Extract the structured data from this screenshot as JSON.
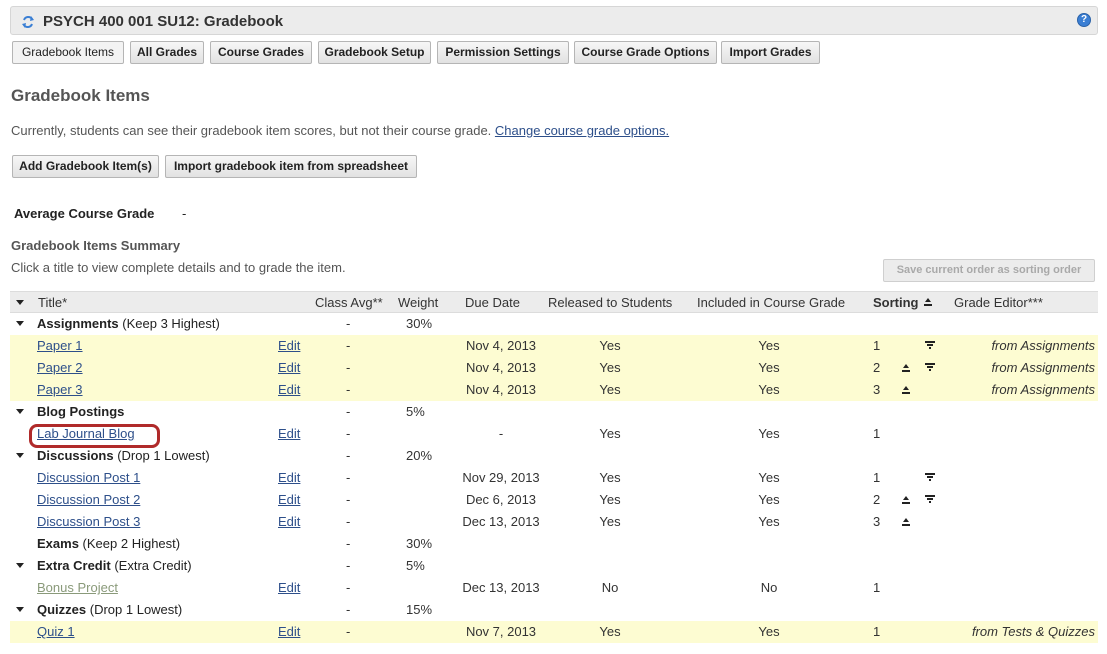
{
  "site_title": "PSYCH 400 001 SU12: Gradebook",
  "help_symbol": "?",
  "nav": [
    {
      "label": "Gradebook Items",
      "current": true
    },
    {
      "label": "All Grades"
    },
    {
      "label": "Course Grades"
    },
    {
      "label": "Gradebook Setup"
    },
    {
      "label": "Permission Settings"
    },
    {
      "label": "Course Grade Options"
    },
    {
      "label": "Import Grades"
    }
  ],
  "page_title": "Gradebook Items",
  "notice": {
    "text": "Currently, students can see their gradebook item scores, but not their course grade.",
    "link": "Change course grade options."
  },
  "actions": {
    "add": "Add Gradebook Item(s)",
    "import": "Import gradebook item from spreadsheet"
  },
  "average": {
    "label": "Average Course Grade",
    "value": "-"
  },
  "summary": {
    "title": "Gradebook Items Summary",
    "help": "Click a title to view complete details and to grade the item.",
    "save_order": "Save current order as sorting order"
  },
  "columns": {
    "title": "Title*",
    "class_avg": "Class Avg**",
    "weight": "Weight",
    "due_date": "Due Date",
    "released": "Released to Students",
    "included": "Included in Course Grade",
    "sorting": "Sorting",
    "grade_editor": "Grade Editor***"
  },
  "rows": [
    {
      "kind": "category",
      "name": "Assignments",
      "note": "(Keep 3 Highest)",
      "avg": "-",
      "weight": "30%",
      "expanded": true
    },
    {
      "kind": "item",
      "title": "Paper 1",
      "edit": "Edit",
      "avg": "-",
      "due": "Nov 4, 2013",
      "released": "Yes",
      "included": "Yes",
      "sort": "1",
      "up": false,
      "down": true,
      "editor": "from Assignments",
      "highlight": true
    },
    {
      "kind": "item",
      "title": "Paper 2",
      "edit": "Edit",
      "avg": "-",
      "due": "Nov 4, 2013",
      "released": "Yes",
      "included": "Yes",
      "sort": "2",
      "up": true,
      "down": true,
      "editor": "from Assignments",
      "highlight": true
    },
    {
      "kind": "item",
      "title": "Paper 3",
      "edit": "Edit",
      "avg": "-",
      "due": "Nov 4, 2013",
      "released": "Yes",
      "included": "Yes",
      "sort": "3",
      "up": true,
      "down": false,
      "editor": "from Assignments",
      "highlight": true
    },
    {
      "kind": "category",
      "name": "Blog Postings",
      "note": "",
      "avg": "-",
      "weight": "5%",
      "expanded": true
    },
    {
      "kind": "item",
      "title": "Lab Journal Blog",
      "edit": "Edit",
      "avg": "-",
      "due": "-",
      "released": "Yes",
      "included": "Yes",
      "sort": "1",
      "up": false,
      "down": false,
      "editor": "",
      "highlight": false
    },
    {
      "kind": "category",
      "name": "Discussions",
      "note": "(Drop 1 Lowest)",
      "avg": "-",
      "weight": "20%",
      "expanded": true
    },
    {
      "kind": "item",
      "title": "Discussion Post 1",
      "edit": "Edit",
      "avg": "-",
      "due": "Nov 29, 2013",
      "released": "Yes",
      "included": "Yes",
      "sort": "1",
      "up": false,
      "down": true,
      "editor": "",
      "highlight": false
    },
    {
      "kind": "item",
      "title": "Discussion Post 2",
      "edit": "Edit",
      "avg": "-",
      "due": "Dec 6, 2013",
      "released": "Yes",
      "included": "Yes",
      "sort": "2",
      "up": true,
      "down": true,
      "editor": "",
      "highlight": false
    },
    {
      "kind": "item",
      "title": "Discussion Post 3",
      "edit": "Edit",
      "avg": "-",
      "due": "Dec 13, 2013",
      "released": "Yes",
      "included": "Yes",
      "sort": "3",
      "up": true,
      "down": false,
      "editor": "",
      "highlight": false
    },
    {
      "kind": "category",
      "name": "Exams",
      "note": "(Keep 2 Highest)",
      "avg": "-",
      "weight": "30%",
      "expanded": false
    },
    {
      "kind": "category",
      "name": "Extra Credit",
      "note": "(Extra Credit)",
      "avg": "-",
      "weight": "5%",
      "expanded": true
    },
    {
      "kind": "item",
      "title": "Bonus Project",
      "edit": "Edit",
      "avg": "-",
      "due": "Dec 13, 2013",
      "released": "No",
      "included": "No",
      "sort": "1",
      "up": false,
      "down": false,
      "editor": "",
      "highlight": false,
      "muted": true
    },
    {
      "kind": "category",
      "name": "Quizzes",
      "note": "(Drop 1 Lowest)",
      "avg": "-",
      "weight": "15%",
      "expanded": true
    },
    {
      "kind": "item",
      "title": "Quiz 1",
      "edit": "Edit",
      "avg": "-",
      "due": "Nov 7, 2013",
      "released": "Yes",
      "included": "Yes",
      "sort": "1",
      "up": false,
      "down": false,
      "editor": "from Tests & Quizzes",
      "highlight": true
    }
  ]
}
